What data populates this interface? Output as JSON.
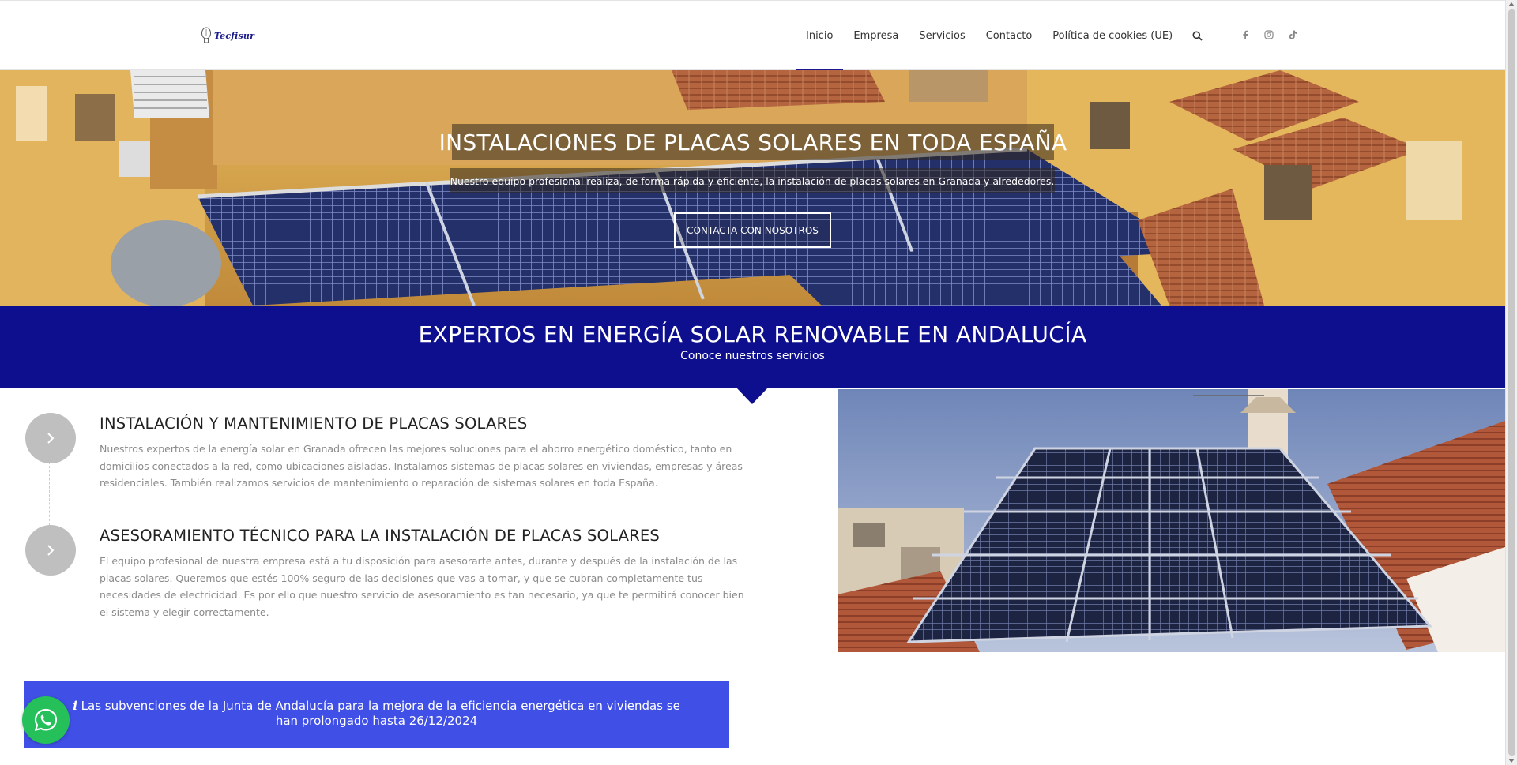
{
  "brand": {
    "logo_text": "Tecfisur"
  },
  "nav": {
    "items": [
      {
        "label": "Inicio",
        "active": true
      },
      {
        "label": "Empresa",
        "active": false
      },
      {
        "label": "Servicios",
        "active": false
      },
      {
        "label": "Contacto",
        "active": false
      },
      {
        "label": "Política de cookies (UE)",
        "active": false
      }
    ],
    "search_icon": "search-icon",
    "social": [
      "facebook-icon",
      "instagram-icon",
      "tiktok-icon"
    ]
  },
  "hero": {
    "title": "INSTALACIONES DE PLACAS SOLARES EN TODA ESPAÑA",
    "subtitle": "Nuestro equipo profesional realiza, de forma rápida y eficiente, la instalación de placas solares en Granada y alrededores.",
    "button": "CONTACTA CON NOSOTROS"
  },
  "band": {
    "title": "EXPERTOS EN ENERGÍA SOLAR RENOVABLE EN ANDALUCÍA",
    "subtitle": "Conoce nuestros servicios"
  },
  "services": [
    {
      "title": "INSTALACIÓN Y MANTENIMIENTO DE PLACAS SOLARES",
      "text": "Nuestros expertos de la energía solar en Granada ofrecen las mejores soluciones para el ahorro energético doméstico, tanto en domicilios conectados a la red, como ubicaciones aisladas. Instalamos sistemas de placas solares en viviendas, empresas y áreas residenciales. También realizamos servicios de mantenimiento o reparación de sistemas solares en toda España."
    },
    {
      "title": "ASESORAMIENTO TÉCNICO PARA LA INSTALACIÓN DE PLACAS SOLARES",
      "text": "El equipo profesional de nuestra empresa está a tu disposición para asesorarte antes, durante y después de la instalación de las placas solares. Queremos que estés 100% seguro de las decisiones que vas a tomar, y que se cubran completamente tus necesidades de electricidad. Es por ello que nuestro servicio de asesoramiento es tan necesario, ya que te permitirá conocer bien el sistema y elegir correctamente."
    }
  ],
  "notice": {
    "icon": "info-icon",
    "text": "Las subvenciones de la Junta de Andalucía para la mejora de la eficiencia energética en viviendas se han prolongado hasta 26/12/2024"
  },
  "colors": {
    "brand_blue": "#0d0f8e",
    "notice_blue": "#4050e6",
    "whatsapp_green": "#25c05a"
  }
}
